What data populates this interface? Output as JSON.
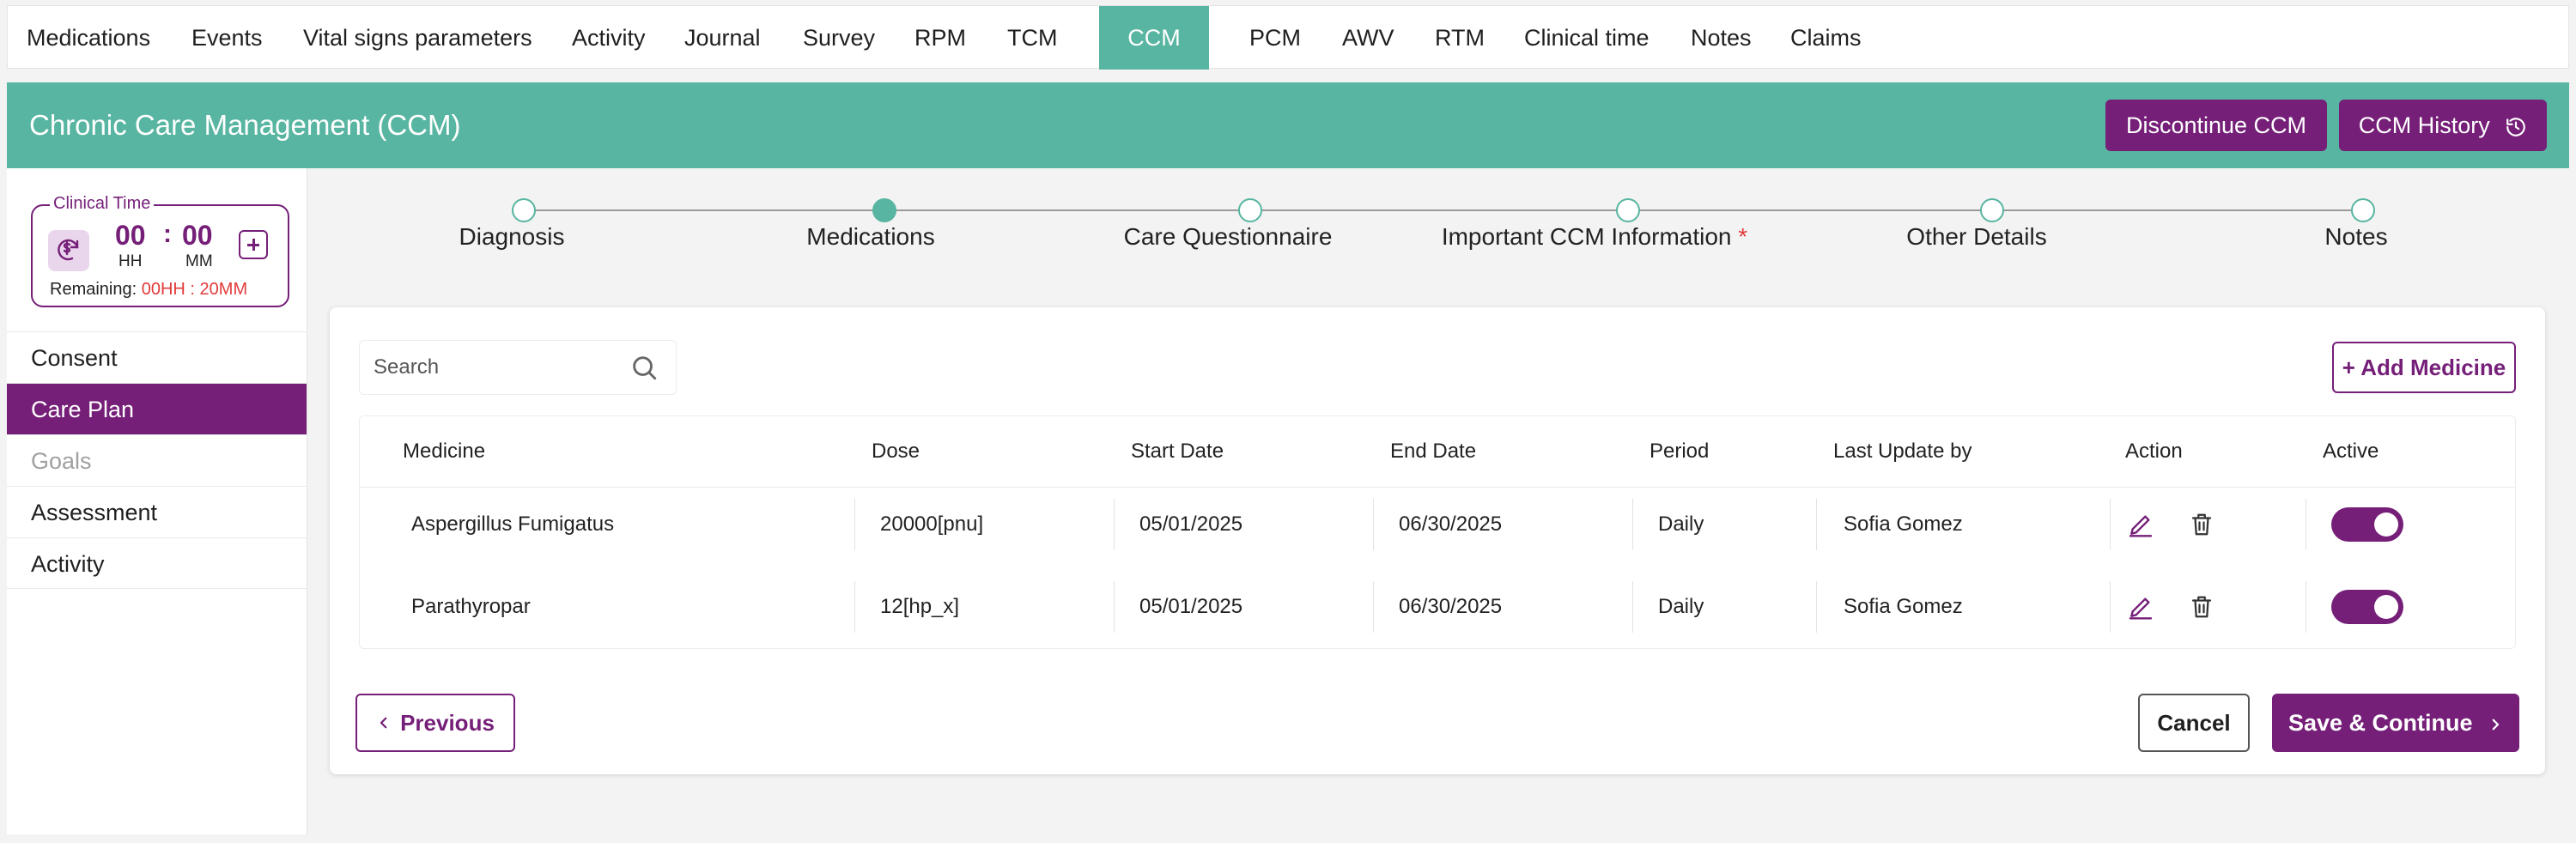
{
  "nav": {
    "tabs": [
      "Medications",
      "Events",
      "Vital signs parameters",
      "Activity",
      "Journal",
      "Survey",
      "RPM",
      "TCM",
      "CCM",
      "PCM",
      "AWV",
      "RTM",
      "Clinical time",
      "Notes",
      "Claims"
    ],
    "active": "CCM"
  },
  "header": {
    "title": "Chronic Care Management (CCM)",
    "discontinue_label": "Discontinue CCM",
    "history_label": "CCM History"
  },
  "clinical_time": {
    "legend": "Clinical Time",
    "hours": "00",
    "minutes": "00",
    "hours_unit": "HH",
    "minutes_unit": "MM",
    "colon": ":",
    "remaining_label": "Remaining:",
    "remaining_value": "00HH : 20MM"
  },
  "sidebar": {
    "items": [
      "Consent",
      "Care Plan",
      "Goals",
      "Assessment",
      "Activity"
    ],
    "active": "Care Plan"
  },
  "stepper": {
    "steps": [
      "Diagnosis",
      "Medications",
      "Care Questionnaire",
      "Important CCM Information",
      "Other Details",
      "Notes"
    ],
    "required_mark": "*",
    "current": "Medications"
  },
  "medications": {
    "search_placeholder": "Search",
    "add_label": "+ Add Medicine",
    "columns": [
      "Medicine",
      "Dose",
      "Start Date",
      "End Date",
      "Period",
      "Last Update by",
      "Action",
      "Active"
    ],
    "rows": [
      {
        "medicine": "Aspergillus Fumigatus",
        "dose": "20000[pnu]",
        "start": "05/01/2025",
        "end": "06/30/2025",
        "period": "Daily",
        "updated_by": "Sofia Gomez",
        "active": true
      },
      {
        "medicine": "Parathyropar",
        "dose": "12[hp_x]",
        "start": "05/01/2025",
        "end": "06/30/2025",
        "period": "Daily",
        "updated_by": "Sofia Gomez",
        "active": true
      }
    ]
  },
  "footer": {
    "previous_label": "Previous",
    "cancel_label": "Cancel",
    "save_label": "Save & Continue"
  },
  "colors": {
    "teal": "#57b5a1",
    "purple": "#751f78",
    "red": "#e23a3a"
  }
}
